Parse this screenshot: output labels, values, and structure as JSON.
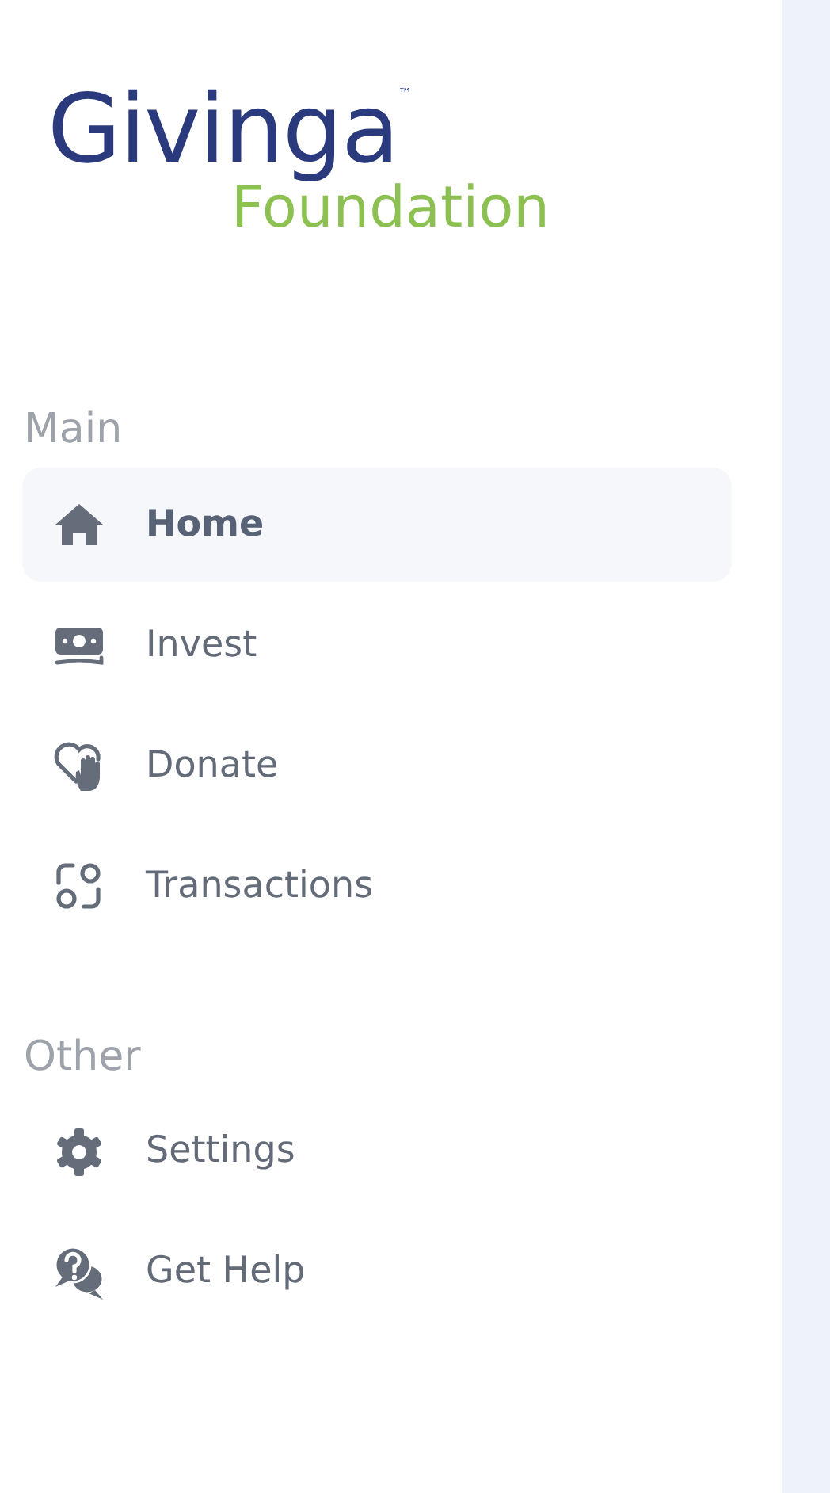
{
  "logo": {
    "name": "Givinga",
    "mark": "™",
    "subtitle": "Foundation"
  },
  "sections": [
    {
      "title": "Main",
      "items": [
        {
          "label": "Home",
          "kind": "home",
          "selected": true
        },
        {
          "label": "Invest",
          "kind": "money",
          "selected": false
        },
        {
          "label": "Donate",
          "kind": "donate",
          "selected": false
        },
        {
          "label": "Transactions",
          "kind": "transactions",
          "selected": false
        }
      ]
    },
    {
      "title": "Other",
      "items": [
        {
          "label": "Settings",
          "kind": "gear",
          "selected": false
        },
        {
          "label": "Get Help",
          "kind": "help",
          "selected": false
        }
      ]
    }
  ]
}
